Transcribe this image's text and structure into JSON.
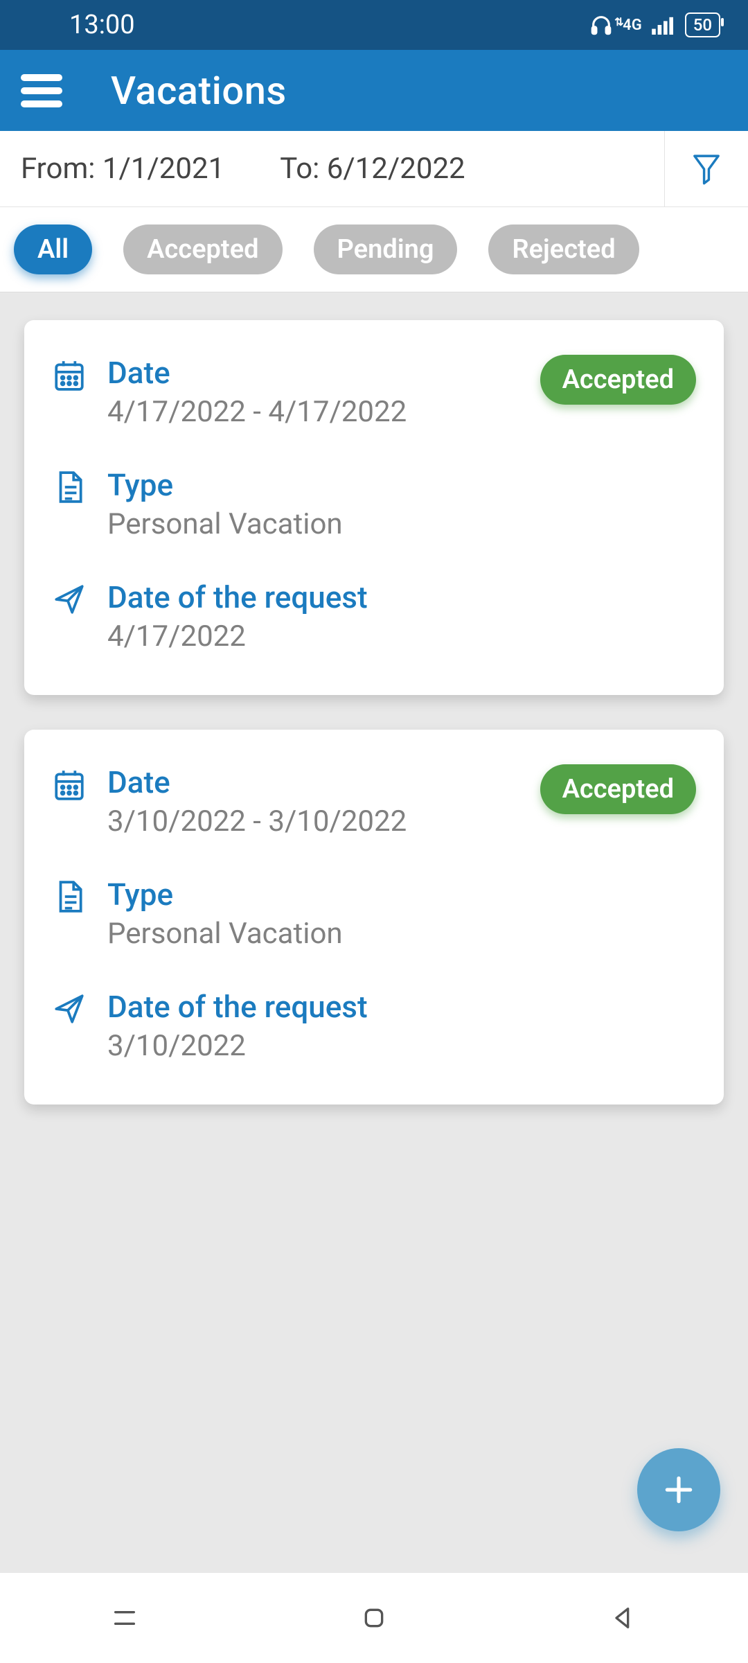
{
  "status": {
    "time": "13:00",
    "network_label": "4G",
    "battery": "50"
  },
  "appbar": {
    "title": "Vacations"
  },
  "filter": {
    "from_label": "From:",
    "from_value": "1/1/2021",
    "to_label": "To:",
    "to_value": "6/12/2022"
  },
  "chips": {
    "all": "All",
    "accepted": "Accepted",
    "pending": "Pending",
    "rejected": "Rejected",
    "active": "all"
  },
  "labels": {
    "date": "Date",
    "type": "Type",
    "request_date": "Date of the request"
  },
  "cards": [
    {
      "date_range": "4/17/2022 - 4/17/2022",
      "type": "Personal Vacation",
      "request_date": "4/17/2022",
      "status": "Accepted"
    },
    {
      "date_range": "3/10/2022 - 3/10/2022",
      "type": "Personal Vacation",
      "request_date": "3/10/2022",
      "status": "Accepted"
    }
  ]
}
